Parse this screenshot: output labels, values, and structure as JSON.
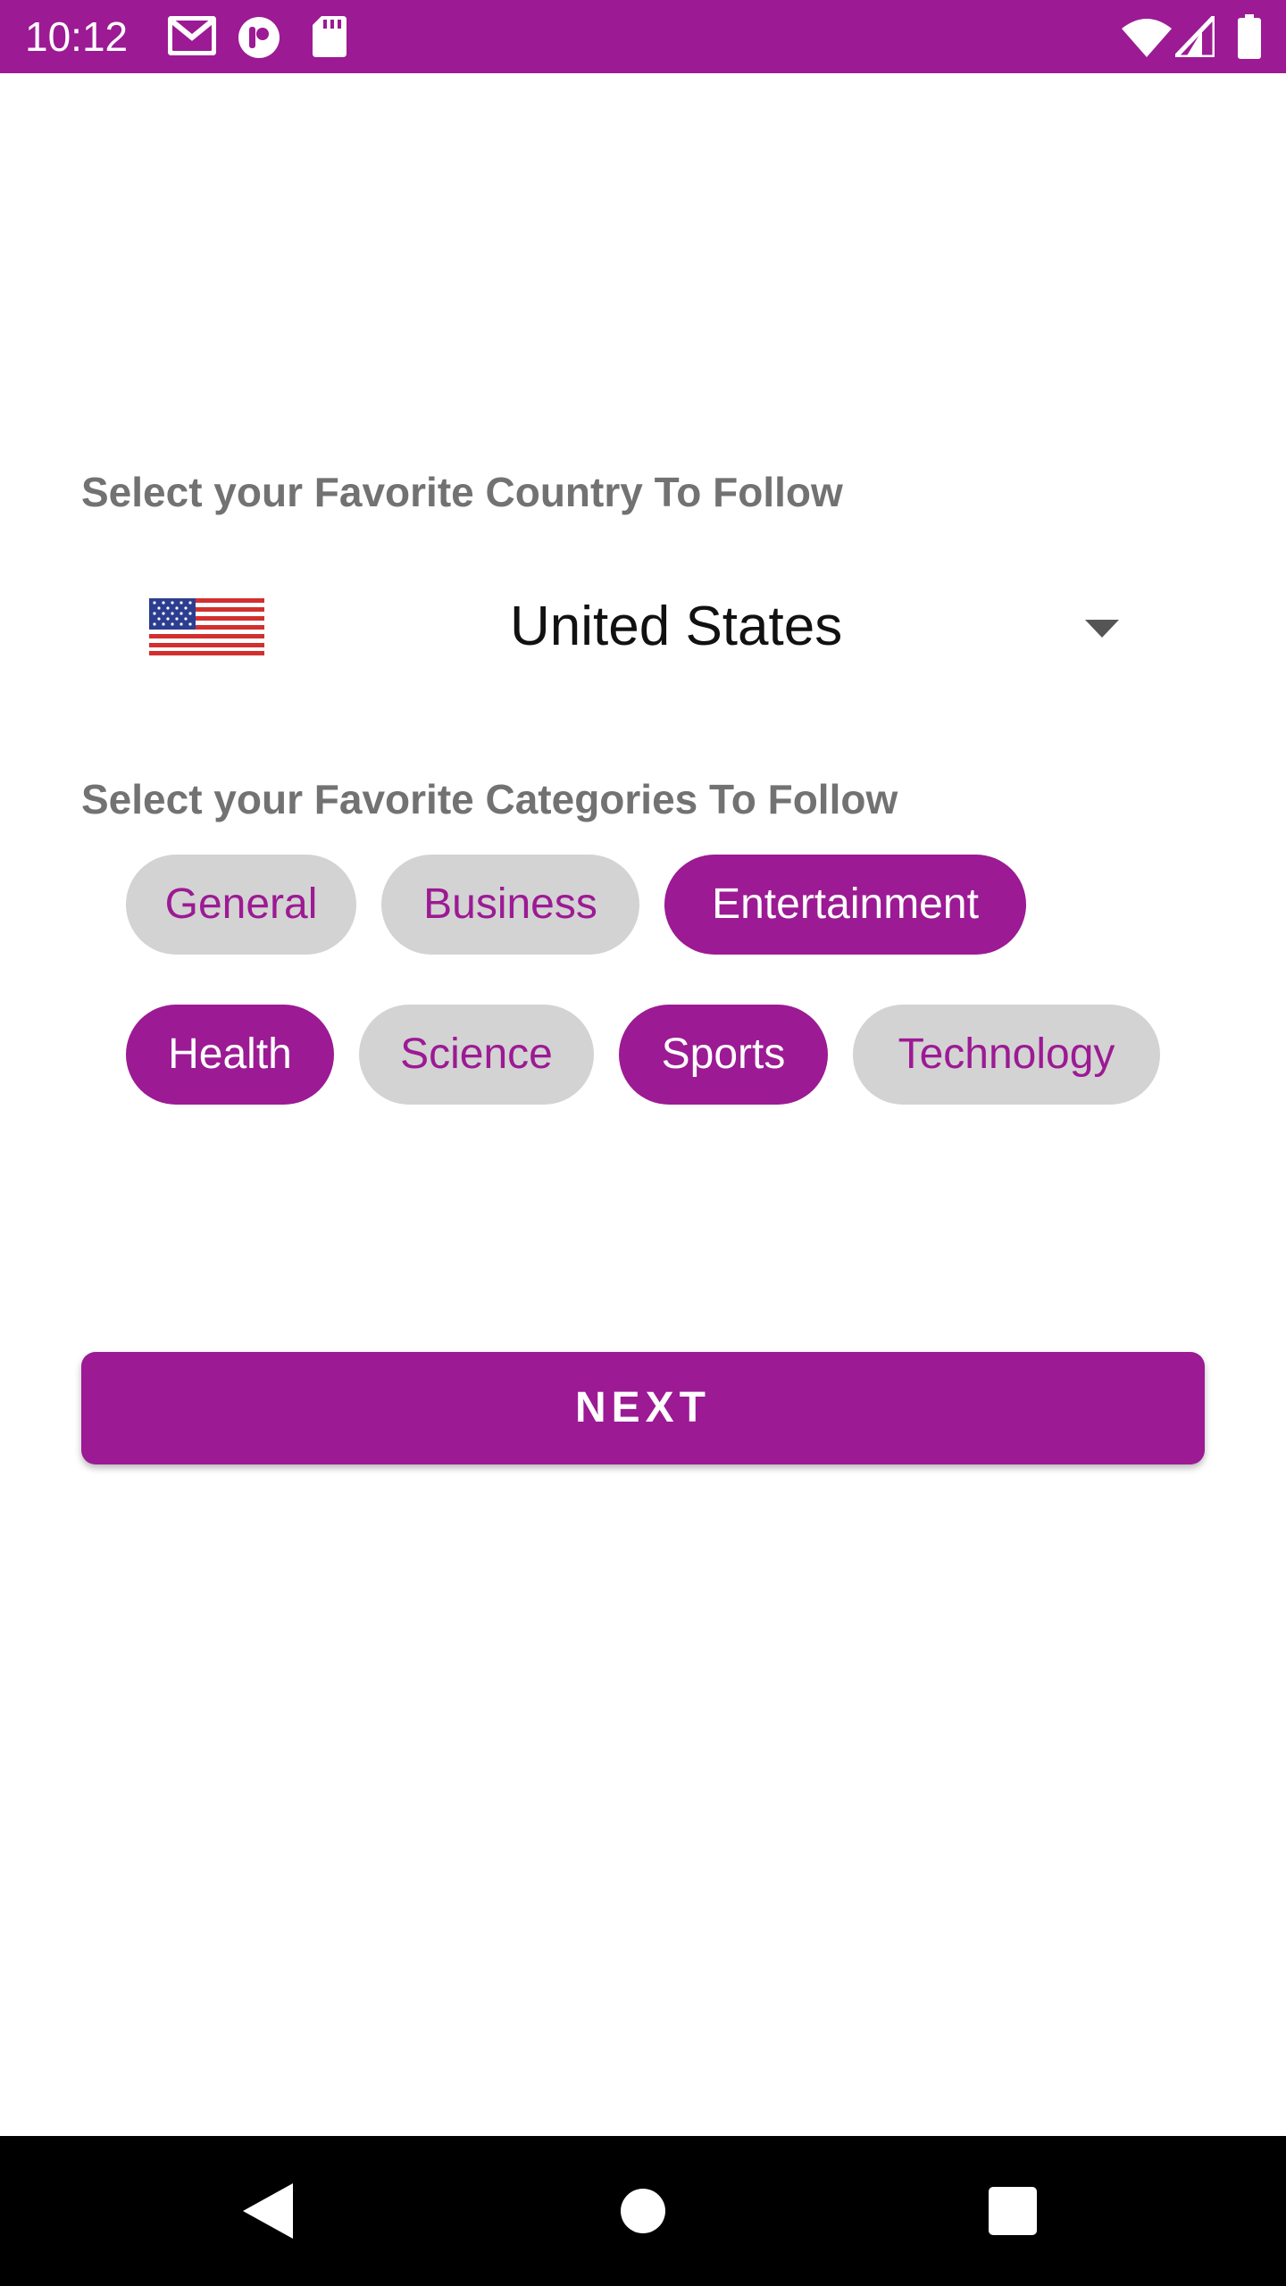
{
  "status_bar": {
    "time": "10:12",
    "icons_left": [
      "gmail-icon",
      "app-notification-icon",
      "sd-card-icon"
    ],
    "icons_right": [
      "wifi-icon",
      "cell-signal-icon",
      "battery-icon"
    ],
    "background_color": "#9c1a94"
  },
  "country_section": {
    "label": "Select your Favorite Country To Follow",
    "selected_country": "United States",
    "flag_icon": "us-flag-icon",
    "dropdown_icon": "dropdown-triangle-icon"
  },
  "categories_section": {
    "label": "Select your Favorite Categories To Follow",
    "chips": [
      {
        "label": "General",
        "selected": false
      },
      {
        "label": "Business",
        "selected": false
      },
      {
        "label": "Entertainment",
        "selected": true
      },
      {
        "label": "Health",
        "selected": true
      },
      {
        "label": "Science",
        "selected": false
      },
      {
        "label": "Sports",
        "selected": true
      },
      {
        "label": "Technology",
        "selected": false
      }
    ]
  },
  "next_button": {
    "label": "NEXT"
  },
  "nav_bar": {
    "back_icon": "back-triangle-icon",
    "home_icon": "home-circle-icon",
    "recents_icon": "recents-square-icon"
  },
  "colors": {
    "accent": "#9c1a94",
    "chip_unselected_bg": "#d3d3d3",
    "label_gray": "#727272"
  }
}
